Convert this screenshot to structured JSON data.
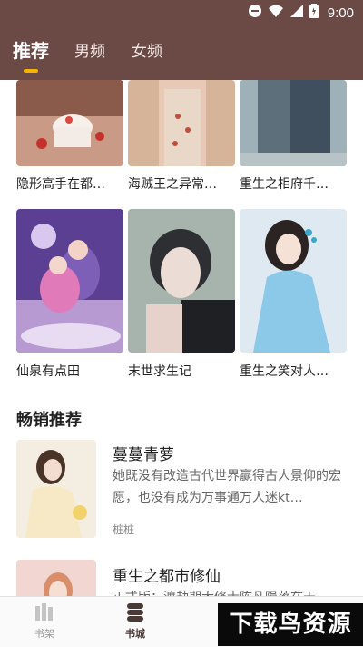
{
  "status_bar": {
    "time": "9:00"
  },
  "top_tabs": [
    {
      "label": "推荐",
      "active": true
    },
    {
      "label": "男频",
      "active": false
    },
    {
      "label": "女频",
      "active": false
    }
  ],
  "grid_books": [
    {
      "title": "隐形高手在都…"
    },
    {
      "title": "海贼王之异常…"
    },
    {
      "title": "重生之相府千…"
    },
    {
      "title": "仙泉有点田"
    },
    {
      "title": "末世求生记"
    },
    {
      "title": "重生之笑对人…"
    }
  ],
  "bestseller": {
    "heading": "畅销推荐",
    "items": [
      {
        "title": "蔓蔓青萝",
        "desc": "她既没有改造古代世界赢得古人景仰的宏愿，也没有成为万事通万人迷kt…",
        "author": "桩桩"
      },
      {
        "title": "重生之都市修仙",
        "desc": "正式版：渡劫期大修士陈凡陨落在天…"
      }
    ]
  },
  "bottom_nav": [
    {
      "label": "书架",
      "icon": "bookshelf-icon",
      "active": false
    },
    {
      "label": "书城",
      "icon": "bookstore-icon",
      "active": true
    }
  ],
  "watermark": "下载鸟资源",
  "colors": {
    "header": "#6b4a45",
    "accent": "#f4b400"
  }
}
